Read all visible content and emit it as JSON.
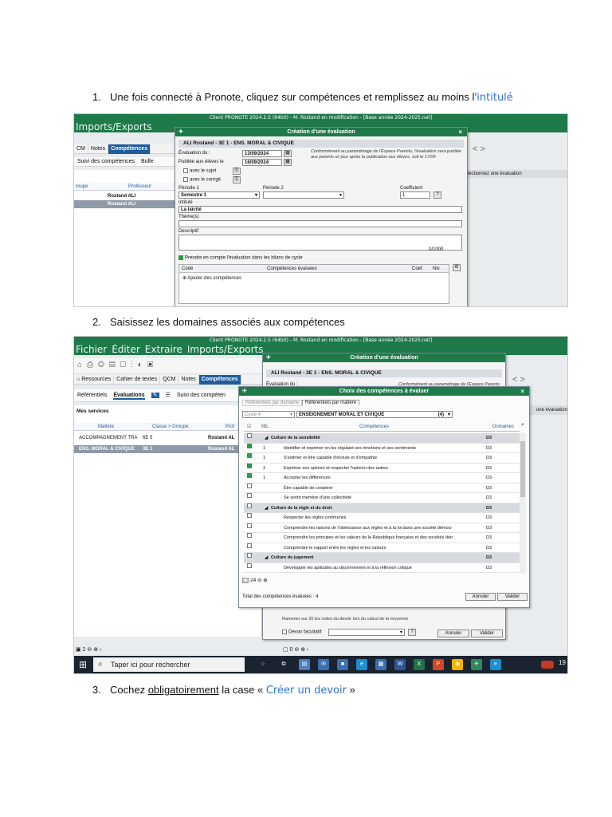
{
  "steps": [
    {
      "number": "1.",
      "text_a": "Une fois connecté à Pronote, cliquez sur compétences et remplissez au moins l’",
      "highlight": "intitulé"
    },
    {
      "number": "2.",
      "text_a": "Saisissez les domaines associés aux compétences"
    },
    {
      "number": "3.",
      "text_a": "Cochez ",
      "underline": "obligatoirement",
      "text_b": " la case « ",
      "highlight": "Créer un devoir",
      "text_c": " »"
    }
  ],
  "shot1": {
    "title": "Client PRONOTE 2024.2.5 (64bit) - M. Rostand en modification - [Base année 2024-2025.net]",
    "menu": [
      "Imports/Exports"
    ],
    "tabs": [
      "CM",
      "Notes",
      "Compétences"
    ],
    "subtabs": [
      "Suivi des compétences",
      "Bulle"
    ],
    "grid_head": [
      "roupe",
      "Professeur"
    ],
    "rows": [
      "Rostand ALI",
      "Rostand ALI"
    ],
    "right_hint": "lectionnez une évaluation",
    "dialog": {
      "title": "Création d'une évaluation",
      "close": "×",
      "header": "ALI Rostand - 3E 1 - ENS. MORAL & CIVIQUE",
      "eval_label": "Évaluation du :",
      "eval_date": "13/09/2024",
      "pub_label": "Publiée aux élèves le",
      "pub_date": "16/09/2024",
      "note": "Conformément au paramétrage de l'Espace Parents, l'évaluation sera publiée aux parents un jour après la publication aux élèves, soit le 17/09",
      "with_subject": "avec le sujet",
      "with_corrige": "avec le corrigé",
      "periode1_label": "Période 1",
      "periode1": "Semestre 1",
      "periode2_label": "Période 2",
      "coef_label": "Coefficient",
      "coef": "1",
      "intitule_label": "Intitulé",
      "intitule": "La laïcité",
      "theme_label": "Thème(s)",
      "descriptif_label": "Descriptif",
      "counter": "0/1000",
      "bilan": "Prendre en compte l'évaluation dans les bilans de cycle",
      "col_code": "Code",
      "col_comp": "Compétences évaluées",
      "col_coef": "Coef.",
      "col_niv": "Niv.",
      "add_comp": "Ajouter des compétences"
    }
  },
  "shot2": {
    "title": "Client PRONOTE 2024.2.5 (64bit) - M. Rostand en modification - [Base année 2024-2025.net]",
    "menu": [
      "Fichier",
      "Éditer",
      "Extraire",
      "Imports/Exports"
    ],
    "tabs": [
      "Ressources",
      "Cahier de textes",
      "QCM",
      "Notes",
      "Compétences"
    ],
    "subtabs": [
      "Référentiels",
      "Évaluations",
      "Suivi des compéten"
    ],
    "services_label": "Mes services",
    "grid_head": [
      "Matière",
      "Classe > Groupe",
      "Prof"
    ],
    "rows": [
      {
        "matiere": "ACCOMPAGNEMENT TRA",
        "classe": "6E 5",
        "prof": "Rostand AL"
      },
      {
        "matiere": "ENS. MORAL & CIVIQUE",
        "classe": "3E 1",
        "prof": "Rostand AL"
      }
    ],
    "back_dialog": {
      "title": "Création d'une évaluation",
      "header": "ALI Rostand - 3E 1 - ENS. MORAL & CIVIQUE",
      "eval_label": "Évaluation du :",
      "note": "Conformément au paramétrage de l'Espace Parents",
      "devoir_facultatif": "Devoir facultatif",
      "cancel": "Annuler",
      "ok": "Valider",
      "hidden_text": "Ramener sur 20 les notes du devoir lors du calcul de la moyenne"
    },
    "front_dialog": {
      "title": "Choix des compétences à évaluer",
      "tab_domaine": "Référentiels par domaine",
      "tab_matiere": "Référentiels par matière",
      "cycle": "Cycle 4",
      "subject": "ENSEIGNEMENT MORAL ET CIVIQUE",
      "count": "(4)",
      "col_nb": "Nb.",
      "col_comp": "Compétences",
      "col_dom": "Domaines",
      "rows": [
        {
          "group": true,
          "label": "Culture de la sensibilité",
          "domain": "D3",
          "checked": false,
          "nb": ""
        },
        {
          "group": false,
          "label": "Identifier et exprimer en les régulant ses émotions et ses sentiments",
          "domain": "D3",
          "checked": true,
          "nb": "1"
        },
        {
          "group": false,
          "label": "S'estimer et être capable d'écoute et d'empathie",
          "domain": "D3",
          "checked": true,
          "nb": "1"
        },
        {
          "group": false,
          "label": "Exprimer son opinion et respecter l'opinion des autres",
          "domain": "D3",
          "checked": true,
          "nb": "1"
        },
        {
          "group": false,
          "label": "Accepter les différences",
          "domain": "D3",
          "checked": true,
          "nb": "1"
        },
        {
          "group": false,
          "label": "Être capable de coopérer",
          "domain": "D3",
          "checked": false,
          "nb": ""
        },
        {
          "group": false,
          "label": "Se sentir membre d'une collectivité",
          "domain": "D3",
          "checked": false,
          "nb": ""
        },
        {
          "group": true,
          "label": "Culture de la règle et du droit",
          "domain": "D3",
          "checked": false,
          "nb": ""
        },
        {
          "group": false,
          "label": "Respecter les règles communes",
          "domain": "D3",
          "checked": false,
          "nb": ""
        },
        {
          "group": false,
          "label": "Comprendre les raisons de l'obéissance aux règles et à la loi dans une société démocr",
          "domain": "D3",
          "checked": false,
          "nb": ""
        },
        {
          "group": false,
          "label": "Comprendre les principes et les valeurs de la République française et des sociétés dén",
          "domain": "D3",
          "checked": false,
          "nb": ""
        },
        {
          "group": false,
          "label": "Comprendre le rapport entre les règles et les valeurs",
          "domain": "D3",
          "checked": false,
          "nb": ""
        },
        {
          "group": true,
          "label": "Culture du jugement",
          "domain": "D3",
          "checked": false,
          "nb": ""
        },
        {
          "group": false,
          "label": "Développer les aptitudes au discernement et à la réflexion critique",
          "domain": "D3",
          "checked": false,
          "nb": ""
        }
      ],
      "footer_count": "24",
      "total": "Total des compétences évaluées : 4",
      "cancel": "Annuler",
      "ok": "Valider"
    },
    "taskbar": {
      "search": "Taper ici pour rechercher",
      "time": "19"
    }
  }
}
